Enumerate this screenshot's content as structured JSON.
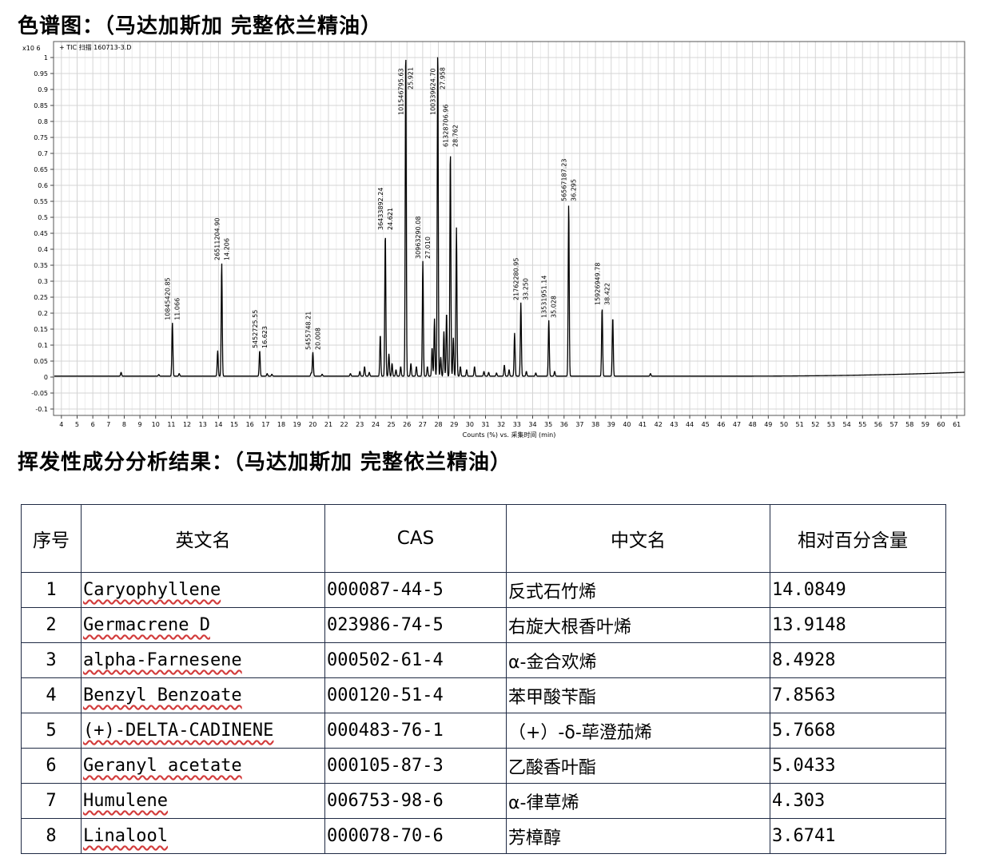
{
  "page": {
    "chart_heading": "色谱图：（马达加斯加 完整依兰精油）",
    "table_heading": "挥发性成分分析结果：（马达加斯加 完整依兰精油）"
  },
  "chart_data": {
    "type": "line",
    "trace_label": "+ TIC 扫描 160713-3.D",
    "scale_label": "x10 6",
    "xlabel": "Counts (%) vs. 采集时间 (min)",
    "xlim": [
      3.5,
      61.5
    ],
    "ylim": [
      -0.12,
      1.05
    ],
    "x_ticks": [
      4,
      5,
      6,
      7,
      8,
      9,
      10,
      11,
      12,
      13,
      14,
      15,
      16,
      17,
      18,
      19,
      20,
      21,
      22,
      23,
      24,
      25,
      26,
      27,
      28,
      29,
      30,
      31,
      32,
      33,
      34,
      35,
      36,
      37,
      38,
      39,
      40,
      41,
      42,
      43,
      44,
      45,
      46,
      47,
      48,
      49,
      50,
      51,
      52,
      53,
      54,
      55,
      56,
      57,
      58,
      59,
      60,
      61
    ],
    "y_ticks": [
      1,
      0.95,
      0.9,
      0.85,
      0.8,
      0.75,
      0.7,
      0.65,
      0.6,
      0.55,
      0.5,
      0.45,
      0.4,
      0.35,
      0.3,
      0.25,
      0.2,
      0.15,
      0.1,
      0.05,
      0,
      -0.05,
      -0.1
    ],
    "y_tick_labels": [
      "1",
      "0.95",
      "0.9",
      "0.85",
      "0.8",
      "0.75",
      "0.7",
      "0.65",
      "0.6",
      "0.55",
      "0.5",
      "0.45",
      "0.4",
      "0.35",
      "0.3",
      "0.25",
      "0.2",
      "0.15",
      "0.1",
      "0.05",
      "0",
      "-0.05",
      "-0.1"
    ],
    "grid": true,
    "line_color": "#000000",
    "peaks": [
      {
        "x": 7.8,
        "y": 0.012
      },
      {
        "x": 10.2,
        "y": 0.005
      },
      {
        "x": 11.066,
        "y": 0.168,
        "area": "10845420.85",
        "rt": "11.066"
      },
      {
        "x": 11.5,
        "y": 0.008
      },
      {
        "x": 13.95,
        "y": 0.08
      },
      {
        "x": 14.206,
        "y": 0.355,
        "area": "26511204.90",
        "rt": "14.206"
      },
      {
        "x": 16.623,
        "y": 0.08,
        "area": "5452725.55",
        "rt": "16.623"
      },
      {
        "x": 17.1,
        "y": 0.008
      },
      {
        "x": 17.4,
        "y": 0.006
      },
      {
        "x": 19.9,
        "y": 0.01
      },
      {
        "x": 20.008,
        "y": 0.075,
        "area": "5455748.21",
        "rt": "20.008"
      },
      {
        "x": 20.6,
        "y": 0.006
      },
      {
        "x": 22.4,
        "y": 0.008
      },
      {
        "x": 23.0,
        "y": 0.015
      },
      {
        "x": 23.3,
        "y": 0.03
      },
      {
        "x": 23.6,
        "y": 0.012
      },
      {
        "x": 24.3,
        "y": 0.13
      },
      {
        "x": 24.621,
        "y": 0.45,
        "area": "36433892.24",
        "rt": "24.621"
      },
      {
        "x": 24.85,
        "y": 0.07
      },
      {
        "x": 25.05,
        "y": 0.04
      },
      {
        "x": 25.3,
        "y": 0.02
      },
      {
        "x": 25.6,
        "y": 0.03
      },
      {
        "x": 25.921,
        "y": 1.03,
        "area": "101546795.63",
        "rt": "25.921"
      },
      {
        "x": 26.25,
        "y": 0.04
      },
      {
        "x": 26.6,
        "y": 0.03
      },
      {
        "x": 27.01,
        "y": 0.36,
        "area": "30963290.08",
        "rt": "27.010"
      },
      {
        "x": 27.3,
        "y": 0.03
      },
      {
        "x": 27.6,
        "y": 0.09
      },
      {
        "x": 27.75,
        "y": 0.18
      },
      {
        "x": 27.958,
        "y": 1.03,
        "area": "100339624.70",
        "rt": "27.958"
      },
      {
        "x": 28.15,
        "y": 0.06
      },
      {
        "x": 28.35,
        "y": 0.14
      },
      {
        "x": 28.52,
        "y": 0.2
      },
      {
        "x": 28.762,
        "y": 0.71,
        "area": "61328706.96",
        "rt": "28.762"
      },
      {
        "x": 28.95,
        "y": 0.12
      },
      {
        "x": 29.15,
        "y": 0.465
      },
      {
        "x": 29.4,
        "y": 0.03
      },
      {
        "x": 29.8,
        "y": 0.02
      },
      {
        "x": 30.3,
        "y": 0.03
      },
      {
        "x": 30.9,
        "y": 0.015
      },
      {
        "x": 31.2,
        "y": 0.012
      },
      {
        "x": 31.7,
        "y": 0.01
      },
      {
        "x": 32.2,
        "y": 0.035
      },
      {
        "x": 32.5,
        "y": 0.02
      },
      {
        "x": 32.85,
        "y": 0.135
      },
      {
        "x": 33.25,
        "y": 0.23,
        "area": "21762280.95",
        "rt": "33.250"
      },
      {
        "x": 33.6,
        "y": 0.015
      },
      {
        "x": 34.2,
        "y": 0.01
      },
      {
        "x": 35.028,
        "y": 0.175,
        "area": "13531951.14",
        "rt": "35.028"
      },
      {
        "x": 35.4,
        "y": 0.015
      },
      {
        "x": 36.295,
        "y": 0.54,
        "area": "56567187.23",
        "rt": "36.295"
      },
      {
        "x": 38.422,
        "y": 0.215,
        "area": "15926949.78",
        "rt": "38.422"
      },
      {
        "x": 39.1,
        "y": 0.185
      },
      {
        "x": 41.5,
        "y": 0.008
      }
    ]
  },
  "table": {
    "headers": [
      "序号",
      "英文名",
      "CAS",
      "中文名",
      "相对百分含量"
    ],
    "rows": [
      [
        "1",
        "Caryophyllene",
        "000087-44-5",
        "反式石竹烯",
        "14.0849"
      ],
      [
        "2",
        "Germacrene D",
        "023986-74-5",
        "右旋大根香叶烯",
        "13.9148"
      ],
      [
        "3",
        "alpha-Farnesene",
        "000502-61-4",
        "α-金合欢烯",
        "8.4928"
      ],
      [
        "4",
        "Benzyl Benzoate",
        "000120-51-4",
        "苯甲酸苄酯",
        "7.8563"
      ],
      [
        "5",
        "(+)-DELTA-CADINENE",
        "000483-76-1",
        "（+）-δ-荜澄茄烯",
        "5.7668"
      ],
      [
        "6",
        "Geranyl acetate",
        "000105-87-3",
        "乙酸香叶酯",
        "5.0433"
      ],
      [
        "7",
        "Humulene",
        "006753-98-6",
        "α-律草烯",
        "4.303"
      ],
      [
        "8",
        "Linalool",
        "000078-70-6",
        "芳樟醇",
        "3.6741"
      ]
    ]
  }
}
